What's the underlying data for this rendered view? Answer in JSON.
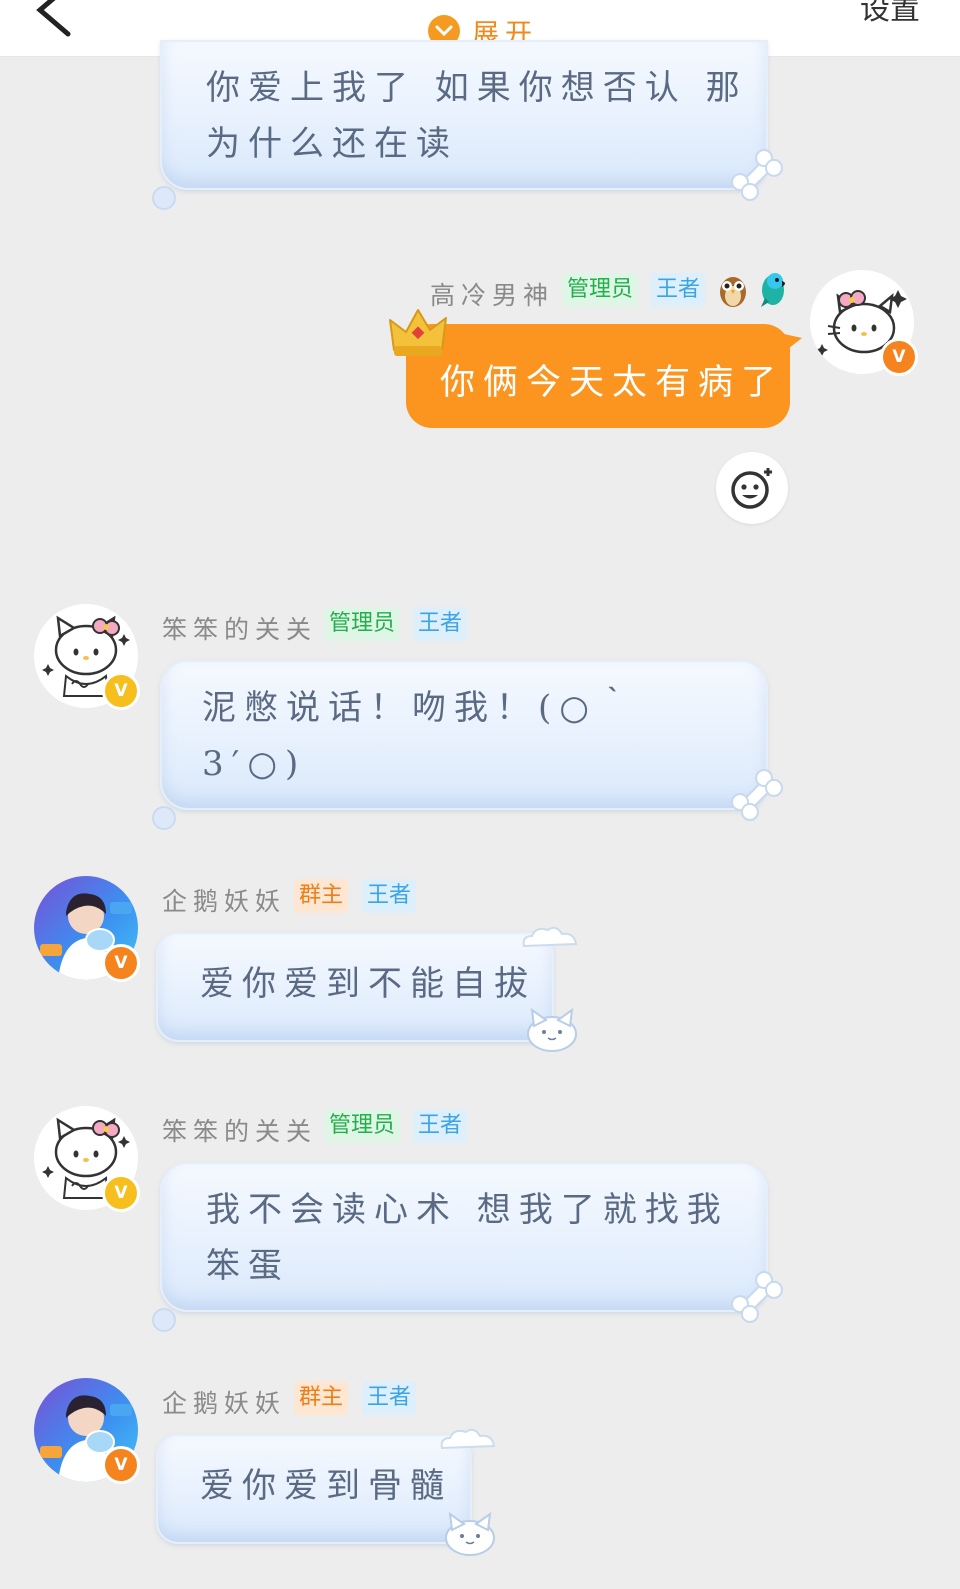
{
  "header": {
    "expand_label": "展开",
    "settings_label": "设置"
  },
  "messages": [
    {
      "text_lines": [
        "你爱上我了 如果你想否认 那",
        "为什么还在读"
      ]
    },
    {
      "sender": "高冷男神",
      "badges": [
        "管理员",
        "王者"
      ],
      "text": "你俩今天太有病了",
      "avatar_badge": "V"
    },
    {
      "sender": "笨笨的关关",
      "badges": [
        "管理员",
        "王者"
      ],
      "text_lines": [
        "泥憋说话！吻我！(○｀",
        "3′○)"
      ],
      "avatar_badge": "V"
    },
    {
      "sender": "企鹅妖妖",
      "badges": [
        "群主",
        "王者"
      ],
      "text": "爱你爱到不能自拔",
      "avatar_badge": "V"
    },
    {
      "sender": "笨笨的关关",
      "badges": [
        "管理员",
        "王者"
      ],
      "text_lines": [
        "我不会读心术 想我了就找我",
        "笨蛋"
      ],
      "avatar_badge": "V"
    },
    {
      "sender": "企鹅妖妖",
      "badges": [
        "群主",
        "王者"
      ],
      "text": "爱你爱到骨髓",
      "avatar_badge": "V"
    }
  ],
  "colors": {
    "background": "#ededed",
    "self_bubble": "#fb9520",
    "tag_admin": "#22b04b",
    "tag_king": "#3aa4e6",
    "tag_owner": "#f07d16",
    "badge_orange": "#f5841f",
    "badge_yellow": "#f6bf1e"
  },
  "icons": [
    "back-icon",
    "chevron-down-icon",
    "add-reaction-icon",
    "crown-icon",
    "owl-icon",
    "parrot-icon",
    "hello-kitty-avatar",
    "person-avatar",
    "bone-decoration",
    "cat-decoration",
    "cloud-decoration"
  ]
}
